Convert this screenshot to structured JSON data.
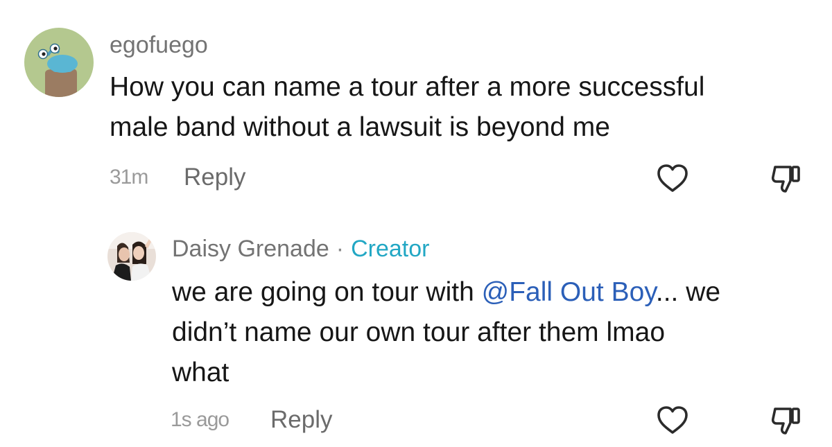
{
  "comments": [
    {
      "username": "egofuego",
      "avatar": "cartoon-character-avatar",
      "lines": [
        "How you can name a tour after a more successful",
        "male band without a lawsuit is beyond me"
      ],
      "time": "31m",
      "reply_label": "Reply",
      "like_icon": "heart-outline-icon",
      "dislike_icon": "thumbs-down-icon"
    },
    {
      "username": "Daisy Grenade",
      "separator": "·",
      "badge": "Creator",
      "avatar": "photo-avatar",
      "line1_before": "we are going on tour with ",
      "mention": "@Fall Out Boy",
      "line1_after": "... we",
      "lines": [
        "didn’t name our own tour after them lmao",
        "what"
      ],
      "time": "1s ago",
      "reply_label": "Reply",
      "like_icon": "heart-outline-icon",
      "dislike_icon": "thumbs-down-icon"
    }
  ],
  "colors": {
    "username": "#737373",
    "body_text": "#161616",
    "creator_badge": "#22a7c4",
    "mention": "#2b5fb8",
    "timestamp": "#9a9a9a",
    "reply": "#6b6b6b",
    "icon": "#2b2b2b"
  }
}
